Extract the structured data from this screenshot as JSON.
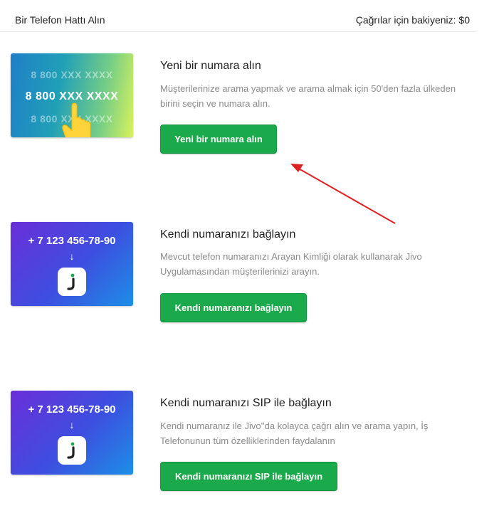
{
  "header": {
    "title": "Bir Telefon Hattı Alın",
    "balance": "Çağrılar için bakiyeniz: $0"
  },
  "sections": [
    {
      "card": {
        "lines": [
          "8 800 XXX XXXX",
          "8 800 XXX XXXX",
          "8 800 XXX XXXX"
        ],
        "icon": "pointing-hand-icon"
      },
      "title": "Yeni bir numara alın",
      "description": "Müşterilerinize arama yapmak ve arama almak için 50'den fazla ülkeden birini seçin ve numara alın.",
      "button": "Yeni bir numara alın"
    },
    {
      "card": {
        "phone": "+ 7 123 456-78-90",
        "arrow": "↓",
        "icon": "jivo-app-icon"
      },
      "title": "Kendi numaranızı bağlayın",
      "description": "Mevcut telefon numaranızı Arayan Kimliği olarak kullanarak Jivo Uygulamasından müşterilerinizi arayın.",
      "button": "Kendi numaranızı bağlayın"
    },
    {
      "card": {
        "phone": "+ 7 123 456-78-90",
        "arrow": "↓",
        "icon": "jivo-app-icon"
      },
      "title": "Kendi numaranızı SIP ile bağlayın",
      "description": "Kendi numaranız ile Jivo''da kolayca çağrı alın ve arama yapın, İş Telefonunun tüm özelliklerinden faydalanın",
      "button": "Kendi numaranızı SIP ile bağlayın"
    }
  ],
  "colors": {
    "button": "#1aaa4b",
    "annotation_arrow": "#e02020"
  }
}
